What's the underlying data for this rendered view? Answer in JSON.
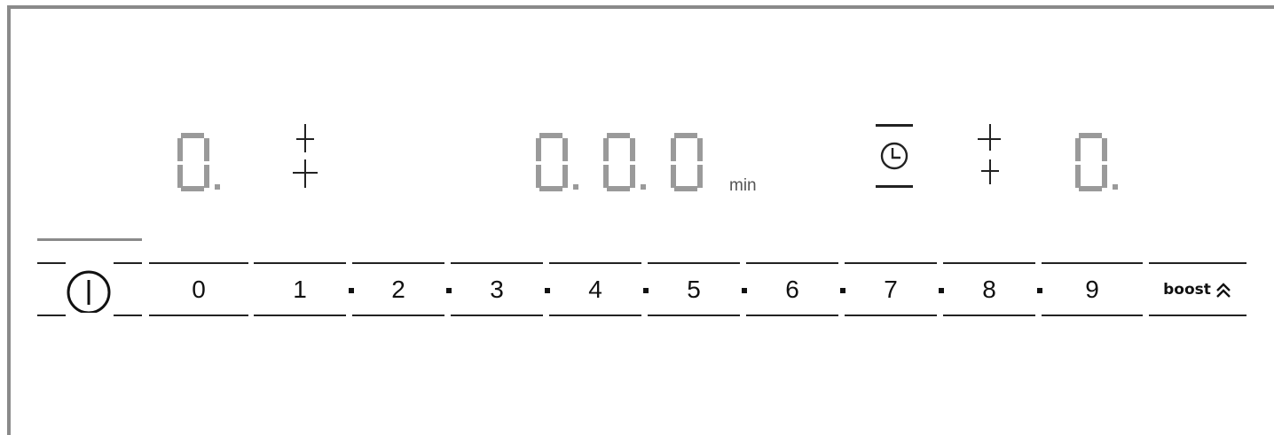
{
  "display": {
    "left_zone_digit": "0",
    "timer_digits": [
      "0",
      "0",
      "0"
    ],
    "timer_unit": "min",
    "right_zone_digit": "0"
  },
  "icons": [
    "power-icon",
    "timer-clock-icon",
    "heat-indicator-icon",
    "boost-chevron-icon"
  ],
  "slider": {
    "keys": [
      "0",
      "1",
      "2",
      "3",
      "4",
      "5",
      "6",
      "7",
      "8",
      "9"
    ],
    "boost_label": "boost",
    "boost_symbol": "≈"
  },
  "colors": {
    "segment_off": "#9a9a9a",
    "frame": "#8a8a8a",
    "text": "#111111"
  }
}
